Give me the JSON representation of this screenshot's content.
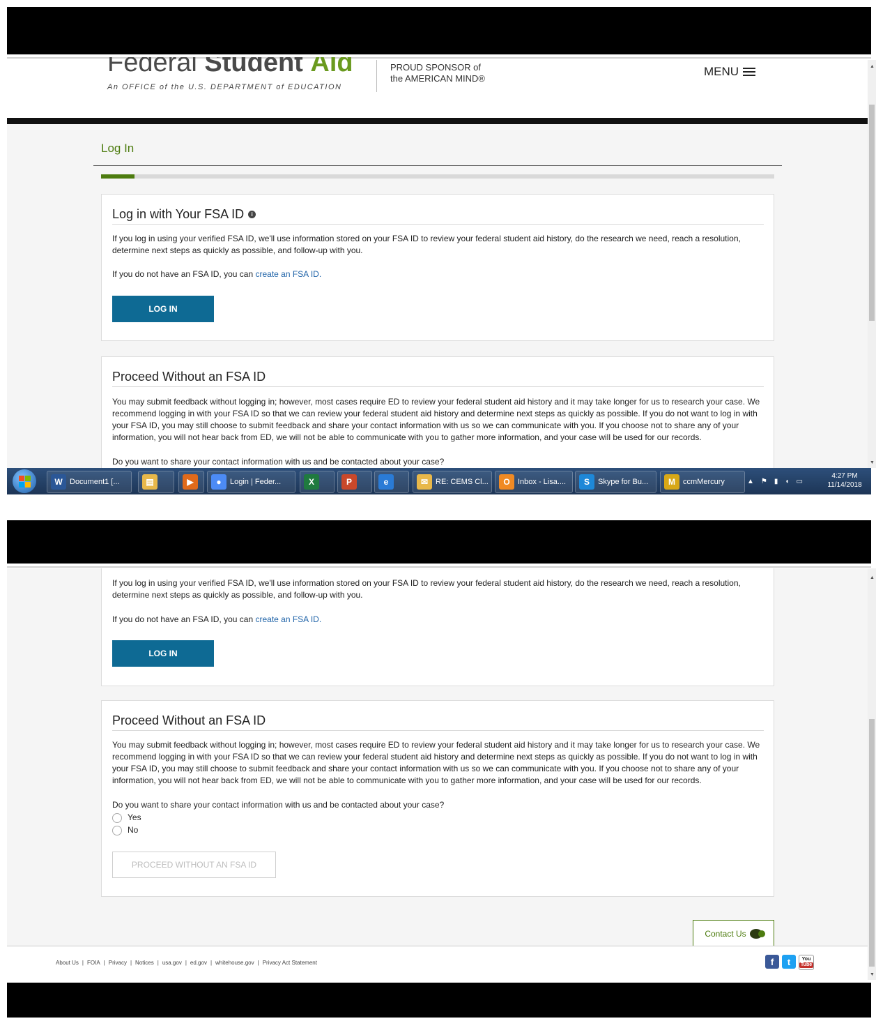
{
  "header": {
    "logo_text_part1": "Federal",
    "logo_text_part2": "Student",
    "logo_text_part3": "Aid",
    "logo_subtitle": "An OFFICE of the U.S. DEPARTMENT of EDUCATION",
    "sponsor_line1": "PROUD SPONSOR of",
    "sponsor_line2": "the AMERICAN MIND®",
    "menu_label": "MENU"
  },
  "page": {
    "title": "Log In",
    "progress": 0.05
  },
  "login_section": {
    "title": "Log in with Your FSA ID",
    "paragraph": "If you log in using your verified FSA ID, we'll use information stored on your FSA ID to review your federal student aid history, do the research we need, reach a resolution, determine next steps as quickly as possible, and follow-up with you.",
    "no_id_prefix": "If you do not have an FSA ID, you can ",
    "create_link": "create an FSA ID.",
    "button": "LOG IN"
  },
  "proceed_section": {
    "title": "Proceed Without an FSA ID",
    "paragraph": "You may submit feedback without logging in; however, most cases require ED to review your federal student aid history and it may take longer for us to research your case. We recommend logging in with your FSA ID so that we can review your federal student aid history and determine next steps as quickly as possible. If you do not want to log in with your FSA ID, you may still choose to submit feedback and share your contact information with us so we can communicate with you. If you choose not to share any of your information, you will not hear back from ED, we will not be able to communicate with you to gather more information, and your case will be used for our records.",
    "question": "Do you want to share your contact information with us and be contacted about your case?",
    "option_yes": "Yes",
    "option_no": "No",
    "button": "PROCEED WITHOUT AN FSA ID"
  },
  "contact": {
    "label": "Contact Us"
  },
  "footer": {
    "links": [
      "About Us",
      "FOIA",
      "Privacy",
      "Notices",
      "usa.gov",
      "ed.gov",
      "whitehouse.gov",
      "Privacy Act Statement"
    ],
    "separator": "|",
    "social": {
      "facebook": "f",
      "twitter": "t",
      "youtube_top": "You",
      "youtube_bottom": "Tube"
    }
  },
  "taskbar": {
    "items": [
      {
        "label": "Document1 [...",
        "icon": "W",
        "color": "#2b5797"
      },
      {
        "label": "",
        "icon": "▤",
        "color": "#e8b84a"
      },
      {
        "label": "",
        "icon": "▶",
        "color": "#e06a1b"
      },
      {
        "label": "Login | Feder...",
        "icon": "●",
        "color": "#4c8bf5"
      },
      {
        "label": "",
        "icon": "X",
        "color": "#1f7a3f"
      },
      {
        "label": "",
        "icon": "P",
        "color": "#c9482a"
      },
      {
        "label": "",
        "icon": "e",
        "color": "#2a7bd6"
      },
      {
        "label": "RE: CEMS Cl...",
        "icon": "✉",
        "color": "#e8b84a"
      },
      {
        "label": "Inbox - Lisa....",
        "icon": "O",
        "color": "#f08a24"
      },
      {
        "label": "Skype for Bu...",
        "icon": "S",
        "color": "#1e88d8"
      },
      {
        "label": "ccmMercury",
        "icon": "M",
        "color": "#d8a817"
      }
    ],
    "time": "4:27 PM",
    "date": "11/14/2018"
  },
  "colors": {
    "accent_green": "#4d7c0f",
    "button_blue": "#0e6a94",
    "link_blue": "#1f63a8"
  }
}
